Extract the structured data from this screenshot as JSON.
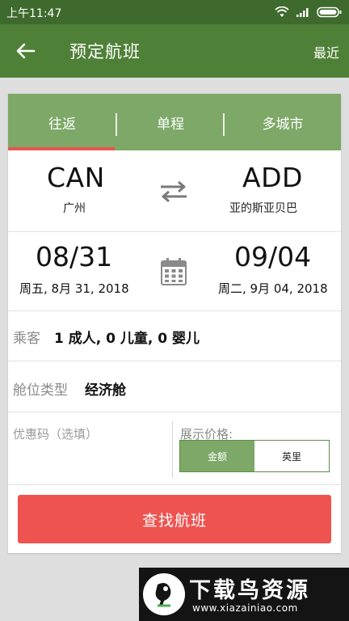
{
  "status": {
    "time": "上午11:47"
  },
  "header": {
    "title": "预定航班",
    "recent_label": "最近"
  },
  "tabs": [
    {
      "label": "往返",
      "selected": true
    },
    {
      "label": "单程",
      "selected": false
    },
    {
      "label": "多城市",
      "selected": false
    }
  ],
  "route": {
    "from_code": "CAN",
    "from_city": "广州",
    "to_code": "ADD",
    "to_city": "亚的斯亚贝巴"
  },
  "dates": {
    "depart_short": "08/31",
    "depart_long": "周五, 8月 31, 2018",
    "return_short": "09/04",
    "return_long": "周二, 9月 04, 2018"
  },
  "passengers": {
    "label": "乘客",
    "value": "1 成人, 0 儿童, 0 婴儿"
  },
  "cabin": {
    "label": "舱位类型",
    "value": "经济舱"
  },
  "promo": {
    "placeholder": "优惠码（选填）"
  },
  "price_display": {
    "label": "展示价格:",
    "options": [
      {
        "label": "金额",
        "selected": true
      },
      {
        "label": "英里",
        "selected": false
      }
    ]
  },
  "search_button": {
    "label": "查找航班"
  },
  "watermark": {
    "text": "下载鸟资源",
    "url": "www.xiazainiao.com"
  },
  "colors": {
    "status_bar": "#3f6a2e",
    "app_bar": "#4f8037",
    "tab_bar": "#7da867",
    "accent_red": "#ee5350",
    "background": "#dedede"
  }
}
